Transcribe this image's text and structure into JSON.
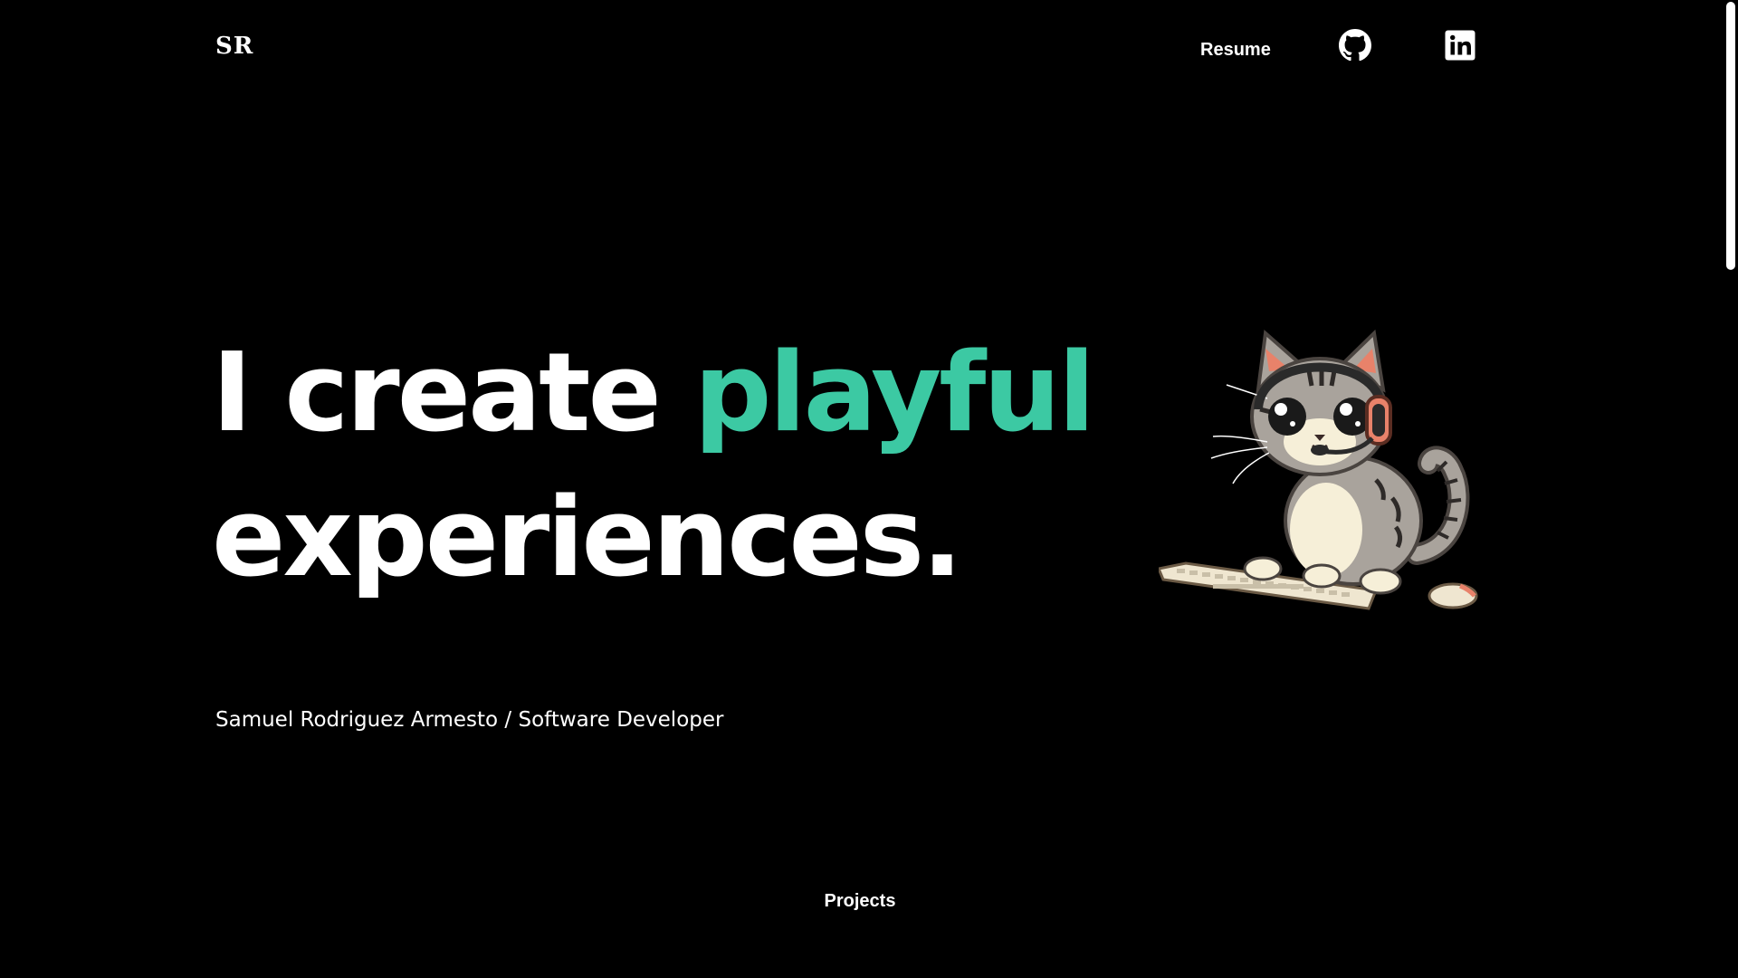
{
  "header": {
    "logo": "SR",
    "resume_label": "Resume",
    "github_icon": "github-icon",
    "linkedin_icon": "linkedin-icon"
  },
  "hero": {
    "line1_start": "I create ",
    "line1_accent": "playful",
    "line2": "experiences.",
    "subtitle": "Samuel Rodriguez Armesto / Software Developer",
    "illustration": "cat-with-headset-and-keyboard"
  },
  "footer_nav": {
    "projects_label": "Projects"
  },
  "colors": {
    "background": "#000000",
    "text": "#ffffff",
    "accent": "#3cc9a3"
  }
}
